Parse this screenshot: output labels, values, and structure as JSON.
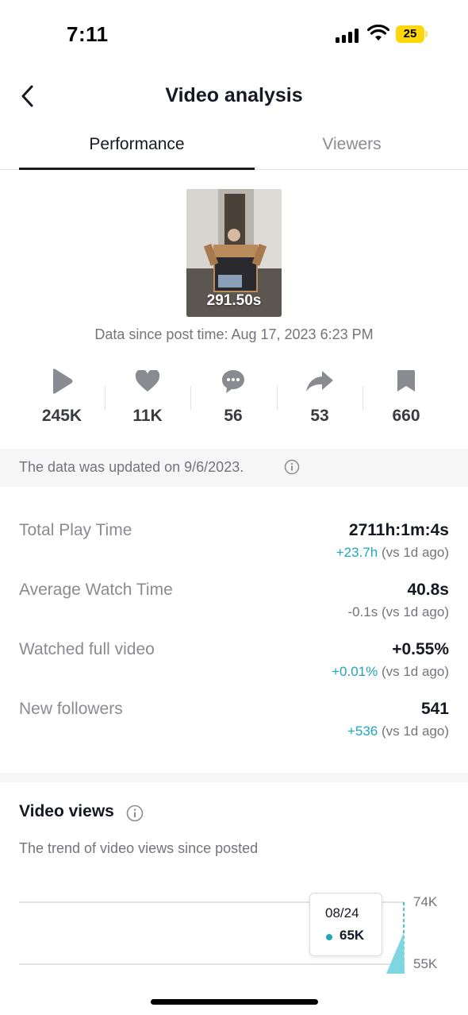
{
  "status_bar": {
    "time": "7:11",
    "battery": "25"
  },
  "header": {
    "title": "Video analysis"
  },
  "tabs": [
    {
      "label": "Performance",
      "active": true
    },
    {
      "label": "Viewers",
      "active": false
    }
  ],
  "video": {
    "duration": "291.50s",
    "post_time": "Data since post time: Aug 17, 2023 6:23 PM"
  },
  "stats": [
    {
      "icon": "play-icon",
      "value": "245K"
    },
    {
      "icon": "heart-icon",
      "value": "11K"
    },
    {
      "icon": "comment-icon",
      "value": "56"
    },
    {
      "icon": "share-icon",
      "value": "53"
    },
    {
      "icon": "bookmark-icon",
      "value": "660"
    }
  ],
  "updated_banner": {
    "text": "The data was updated on 9/6/2023."
  },
  "metrics": [
    {
      "label": "Total Play Time",
      "value": "2711h:1m:4s",
      "change": "+23.7h",
      "suffix": " (vs 1d ago)",
      "positive": true
    },
    {
      "label": "Average Watch Time",
      "value": "40.8s",
      "change": "-0.1s",
      "suffix": " (vs 1d ago)",
      "positive": false
    },
    {
      "label": "Watched full video",
      "value": "+0.55%",
      "change": "+0.01%",
      "suffix": " (vs 1d ago)",
      "positive": true
    },
    {
      "label": "New followers",
      "value": "541",
      "change": "+536",
      "suffix": " (vs 1d ago)",
      "positive": true
    }
  ],
  "video_views": {
    "title": "Video views",
    "subtitle": "The trend of video views since posted",
    "tooltip": {
      "date": "08/24",
      "value": "65K"
    }
  },
  "chart_data": {
    "type": "area",
    "title": "Video views",
    "y_ticks": [
      "74K",
      "55K"
    ],
    "highlight": {
      "x": "08/24",
      "y": "65K"
    },
    "color": "#20a6b8"
  },
  "colors": {
    "accent": "#20a6b8",
    "text_primary": "#161823",
    "text_secondary": "#8a8b91"
  }
}
